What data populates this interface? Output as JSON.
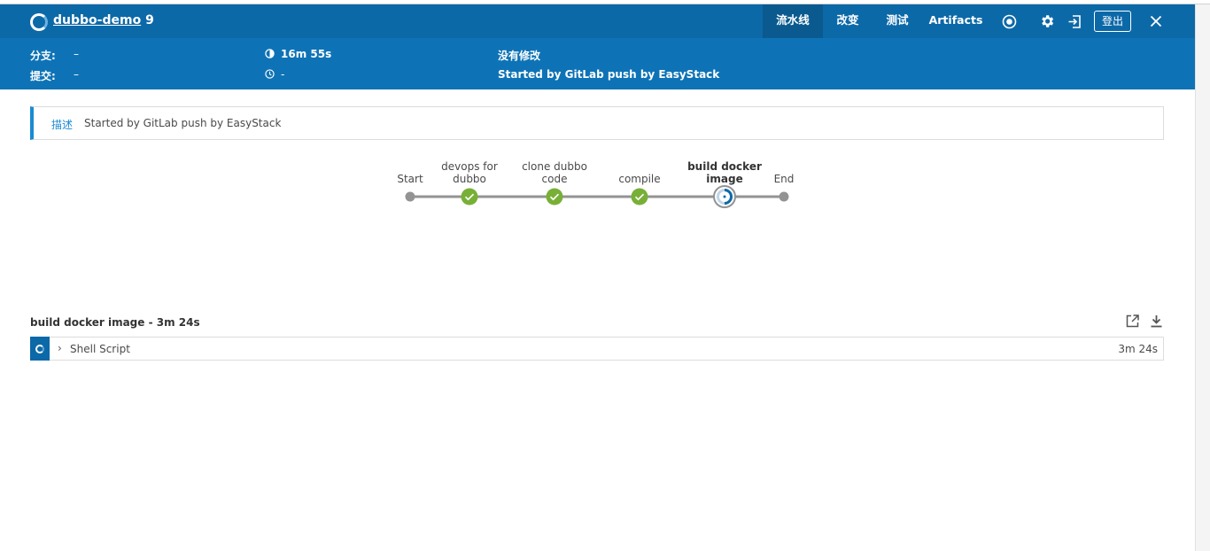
{
  "header": {
    "pipeline_name": "dubbo-demo",
    "run_number": "9",
    "tabs": [
      {
        "label": "流水线",
        "active": true
      },
      {
        "label": "改变",
        "active": false
      },
      {
        "label": "测试",
        "active": false
      },
      {
        "label": "Artifacts",
        "active": false
      }
    ],
    "logout_label": "登出",
    "icons": [
      "stop-icon",
      "gear-icon",
      "sign-in-icon",
      "close-icon"
    ]
  },
  "summary": {
    "branch_label": "分支:",
    "branch_value": "–",
    "commit_label": "提交:",
    "commit_value": "–",
    "duration": "16m 55s",
    "time_ago": "-",
    "changes": "没有修改",
    "cause": "Started by GitLab push by EasyStack"
  },
  "description": {
    "label": "描述",
    "text": "Started by GitLab push by EasyStack"
  },
  "pipeline_graph": {
    "stages": [
      {
        "label_line1": "",
        "label_line2": "Start",
        "status": "start"
      },
      {
        "label_line1": "devops for",
        "label_line2": "dubbo",
        "status": "success"
      },
      {
        "label_line1": "clone dubbo",
        "label_line2": "code",
        "status": "success"
      },
      {
        "label_line1": "",
        "label_line2": "compile",
        "status": "success"
      },
      {
        "label_line1": "build docker",
        "label_line2": "image",
        "status": "running"
      },
      {
        "label_line1": "",
        "label_line2": "End",
        "status": "end"
      }
    ],
    "colors": {
      "success": "#78b037",
      "running": "#0c69a8",
      "terminal": "#949393",
      "edge": "#949393"
    }
  },
  "step_section": {
    "title": "build docker image - 3m 24s",
    "steps": [
      {
        "name": "Shell Script",
        "duration": "3m 24s",
        "status": "running"
      }
    ]
  },
  "colors": {
    "header_bg": "#0c69a8",
    "subheader_bg": "#0e73b6",
    "accent": "#1a8bd1"
  }
}
